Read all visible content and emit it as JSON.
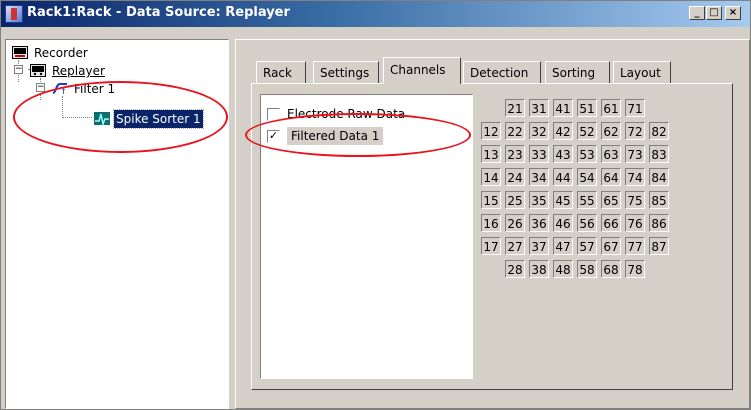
{
  "window": {
    "title": "Rack1:Rack - Data Source: Replayer",
    "minimize": "_",
    "maximize": "□",
    "close": "×"
  },
  "tree": {
    "items": [
      {
        "label": "Recorder",
        "icon": "recorder-icon"
      },
      {
        "label": "Replayer",
        "icon": "replayer-icon"
      },
      {
        "label": "Filter 1",
        "icon": "filter-icon"
      },
      {
        "label": "Spike Sorter 1",
        "icon": "spike-sorter-icon",
        "selected": true
      }
    ]
  },
  "tabs": [
    "Rack",
    "Settings",
    "Channels",
    "Detection",
    "Sorting",
    "Layout"
  ],
  "active_tab": "Channels",
  "data_streams": [
    {
      "label": "Electrode Raw Data",
      "checked": false
    },
    {
      "label": "Filtered Data 1",
      "checked": true
    }
  ],
  "checkmark": "✓",
  "electrode_grid": [
    [
      "",
      "21",
      "31",
      "41",
      "51",
      "61",
      "71",
      ""
    ],
    [
      "12",
      "22",
      "32",
      "42",
      "52",
      "62",
      "72",
      "82"
    ],
    [
      "13",
      "23",
      "33",
      "43",
      "53",
      "63",
      "73",
      "83"
    ],
    [
      "14",
      "24",
      "34",
      "44",
      "54",
      "64",
      "74",
      "84"
    ],
    [
      "15",
      "25",
      "35",
      "45",
      "55",
      "65",
      "75",
      "85"
    ],
    [
      "16",
      "26",
      "36",
      "46",
      "56",
      "66",
      "76",
      "86"
    ],
    [
      "17",
      "27",
      "37",
      "47",
      "57",
      "67",
      "77",
      "87"
    ],
    [
      "",
      "28",
      "38",
      "48",
      "58",
      "68",
      "78",
      ""
    ]
  ],
  "colors": {
    "annotation": "#e8141e",
    "selection": "#0a246a"
  }
}
